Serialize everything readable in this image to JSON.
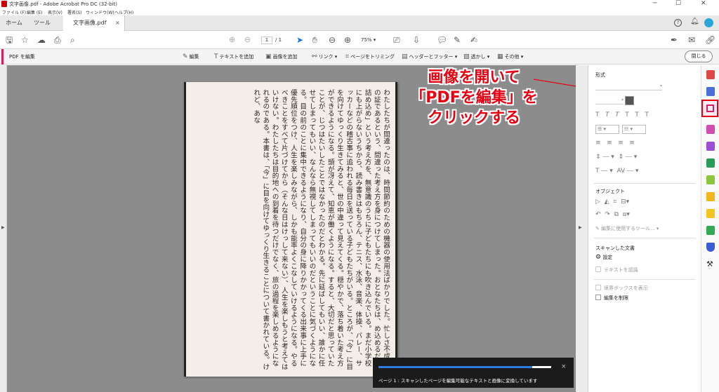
{
  "window": {
    "title": "文字画像.pdf - Adobe Acrobat Pro DC (32-bit)",
    "minimize": "─",
    "maximize": "☐",
    "close": "✕"
  },
  "menu": [
    "ファイル (F)",
    "編集 (E)",
    "表示(V)",
    "署名(S)",
    "ウィンドウ(W)",
    "ヘルプ(H)"
  ],
  "tabs": {
    "home": "ホーム",
    "tools": "ツール",
    "doc": "文字画像.pdf",
    "doc_close": "×"
  },
  "toolbar": {
    "page_current": "1",
    "page_total": "/ 1",
    "zoom": "75%"
  },
  "editbar": {
    "label": "PDF を編集",
    "items": [
      "編集",
      "テキストを追加",
      "画像を追加",
      "リンク",
      "ページをトリミング",
      "ヘッダーとフッター",
      "透かし",
      "その他"
    ],
    "close": "閉じる"
  },
  "page_text": "わたしたちが間違ったのは、時間節約のための機器の使用法ばかりでした。忙しさ不成功の証であるという、間違った考え方を身につけてしまった。おとなたちは、め込めるだけ詰め込め」という考え方を、無意識のうちに子どもたちにも吹き込んでいる。まだ小学校にも上がらないうちから、読み書きはもちろん、テニス、水泳、音楽、体操、バレー、サッカーなどの稽古事に追われる毎日を送っている子どもたちがいる。ところが、「今」に目を向けてゆっくり生きてみると、世の中違って見えてくる。穏やかで、落ち着いた考え方ができるようになる。頭が冴えて、知恵が働くようになる。すると、大切だと思っていたことが、じつはたいしたことではなかったのだとわかる。先に延ばしてもいい、誰かに任せてしまってもいい、なんなら無視してしまってもいいのだということに気づくようになる。目の前のことに集中できるようになり、自分の身に降りかかってくる出来事に上手に優先順位をつけ、人生を楽しみながら、しかも能率よくこなしていけるようになる。やるべきことをすべて片づけてから（そんな日はけっして来ない）、人生を楽しもうと考えてはいけない。わたしたちは目的地への到着を待つだけでなく、旅の過程を楽しめるようになれるのである。本書は、「今」に目を向けてゆっくり生きることについて書かれている。けれど、あな",
  "callout": {
    "line1": "画像を開いて",
    "line2": "「PDFを編集」を",
    "line3": "クリックする"
  },
  "progress": {
    "fraction": 0.89,
    "message": "ページ 1 : スキャンしたページを編集可能なテキストと画像に変換しています",
    "close": "×"
  },
  "panel": {
    "format_heading": "形式",
    "object_heading": "オブジェクト",
    "edit_with_tool": "編集に使用するツール...",
    "scanned_heading": "スキャンした文書",
    "settings": "設定",
    "recognize_text": "テキストを認識",
    "show_bounding_boxes": "境界ボックスを表示",
    "restrict_editing": "編集を制限"
  },
  "colors": {
    "accent_red": "#e60012",
    "pink": "#d81b60",
    "progress_blue": "#2d7de0"
  }
}
